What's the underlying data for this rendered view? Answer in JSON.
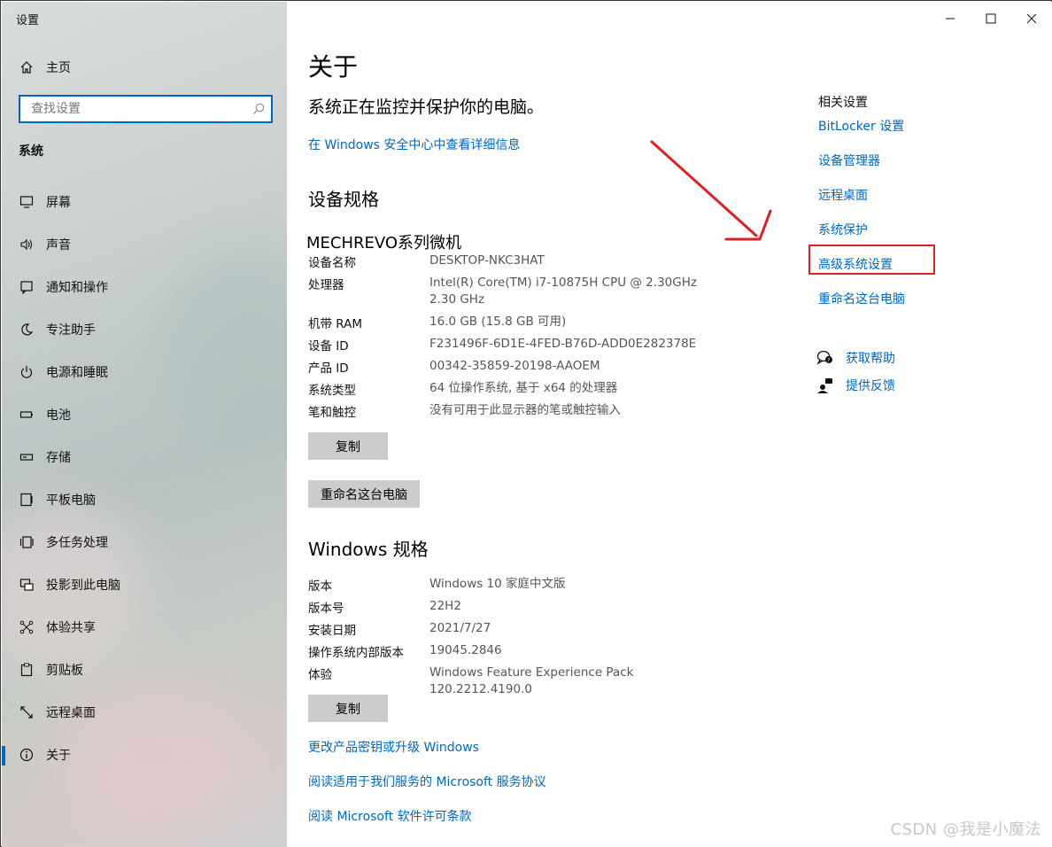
{
  "window": {
    "title": "设置"
  },
  "sidebar": {
    "home_label": "主页",
    "search_placeholder": "查找设置",
    "section_heading": "系统",
    "items": [
      {
        "label": "屏幕",
        "icon": "monitor-icon"
      },
      {
        "label": "声音",
        "icon": "speaker-icon"
      },
      {
        "label": "通知和操作",
        "icon": "notification-icon"
      },
      {
        "label": "专注助手",
        "icon": "moon-icon"
      },
      {
        "label": "电源和睡眠",
        "icon": "power-icon"
      },
      {
        "label": "电池",
        "icon": "battery-icon"
      },
      {
        "label": "存储",
        "icon": "storage-icon"
      },
      {
        "label": "平板电脑",
        "icon": "tablet-icon"
      },
      {
        "label": "多任务处理",
        "icon": "multitask-icon"
      },
      {
        "label": "投影到此电脑",
        "icon": "project-icon"
      },
      {
        "label": "体验共享",
        "icon": "share-icon"
      },
      {
        "label": "剪贴板",
        "icon": "clipboard-icon"
      },
      {
        "label": "远程桌面",
        "icon": "remote-desktop-icon"
      },
      {
        "label": "关于",
        "icon": "info-icon",
        "active": true
      }
    ]
  },
  "main": {
    "title": "关于",
    "protection_text": "系统正在监控并保护你的电脑。",
    "security_link": "在 Windows 安全中心中查看详细信息",
    "device_specs_heading": "设备规格",
    "device_model": "MECHREVO系列微机",
    "device_specs": [
      {
        "key": "设备名称",
        "value": "DESKTOP-NKC3HAT"
      },
      {
        "key": "处理器",
        "value": "Intel(R) Core(TM) i7-10875H CPU @ 2.30GHz   2.30 GHz"
      },
      {
        "key": "机带 RAM",
        "value": "16.0 GB (15.8 GB 可用)"
      },
      {
        "key": "设备 ID",
        "value": "F231496F-6D1E-4FED-B76D-ADD0E282378E"
      },
      {
        "key": "产品 ID",
        "value": "00342-35859-20198-AAOEM"
      },
      {
        "key": "系统类型",
        "value": "64 位操作系统, 基于 x64 的处理器"
      },
      {
        "key": "笔和触控",
        "value": "没有可用于此显示器的笔或触控输入"
      }
    ],
    "copy_button_1": "复制",
    "rename_button": "重命名这台电脑",
    "windows_specs_heading": "Windows 规格",
    "windows_specs": [
      {
        "key": "版本",
        "value": "Windows 10 家庭中文版"
      },
      {
        "key": "版本号",
        "value": "22H2"
      },
      {
        "key": "安装日期",
        "value": "2021/7/27"
      },
      {
        "key": "操作系统内部版本",
        "value": "19045.2846"
      },
      {
        "key": "体验",
        "value": "Windows Feature Experience Pack 120.2212.4190.0"
      }
    ],
    "copy_button_2": "复制",
    "bottom_links": [
      "更改产品密钥或升级 Windows",
      "阅读适用于我们服务的 Microsoft 服务协议",
      "阅读 Microsoft 软件许可条款"
    ]
  },
  "related": {
    "heading": "相关设置",
    "links": [
      "BitLocker 设置",
      "设备管理器",
      "远程桌面",
      "系统保护",
      "高级系统设置",
      "重命名这台电脑"
    ],
    "highlighted": "高级系统设置",
    "help_links": [
      {
        "label": "获取帮助",
        "icon": "help-chat-icon"
      },
      {
        "label": "提供反馈",
        "icon": "feedback-icon"
      }
    ]
  },
  "annotation": {
    "arrow_color": "#e02020"
  },
  "watermark": "CSDN @我是小魔法",
  "colors": {
    "accent": "#0067c0",
    "button_bg": "#cccccc",
    "highlight_border": "#e02020"
  }
}
